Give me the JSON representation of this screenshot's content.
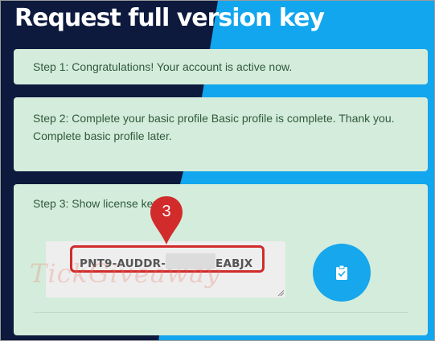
{
  "page": {
    "title": "Request full version key"
  },
  "steps": [
    {
      "text": "Step 1: Congratulations! Your account is active now."
    },
    {
      "text": "Step 2: Complete your basic profile Basic profile is complete. Thank you. Complete basic profile later."
    },
    {
      "text": "Step 3: Show license key"
    }
  ],
  "license": {
    "key_prefix": "PNT9-AUDDR-",
    "key_suffix": "EABJX"
  },
  "annotation": {
    "callout_number": "3"
  },
  "watermark": {
    "text": "TickGiveaway"
  },
  "copy_button": {
    "icon": "clipboard-check-icon"
  },
  "colors": {
    "dark_navy": "#0d1a3d",
    "bright_blue": "#12a6ee",
    "card_green": "#d4ecdb",
    "callout_red": "#d12b2b"
  }
}
